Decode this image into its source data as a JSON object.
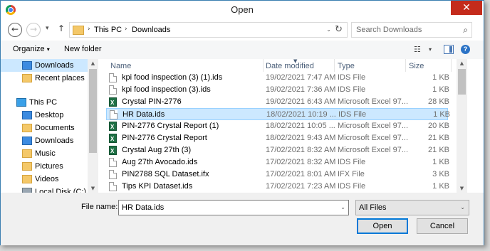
{
  "window": {
    "title": "Open",
    "close_glyph": "✕"
  },
  "nav": {
    "back_glyph": "←",
    "forward_glyph": "→",
    "recent_glyph": "▾",
    "up_glyph": "↑",
    "address": [
      "This PC",
      "Downloads"
    ],
    "address_sep": "›",
    "dropdown_glyph": "⌄",
    "refresh_glyph": "↻",
    "search_placeholder": "Search Downloads",
    "search_glyph": "⌕"
  },
  "toolbar": {
    "organize_label": "Organize",
    "organize_caret": "▾",
    "new_folder_label": "New folder",
    "view_glyph": "☷",
    "view_caret": "▾",
    "help_glyph": "?"
  },
  "sidebar": {
    "items": [
      {
        "label": "Downloads",
        "icon": "downloads-folder-icon",
        "selected": true
      },
      {
        "label": "Recent places",
        "icon": "recent-places-icon"
      },
      {
        "label": "This PC",
        "icon": "this-pc-icon"
      },
      {
        "label": "Desktop",
        "icon": "desktop-folder-icon"
      },
      {
        "label": "Documents",
        "icon": "documents-folder-icon"
      },
      {
        "label": "Downloads",
        "icon": "downloads-folder-icon"
      },
      {
        "label": "Music",
        "icon": "music-folder-icon"
      },
      {
        "label": "Pictures",
        "icon": "pictures-folder-icon"
      },
      {
        "label": "Videos",
        "icon": "videos-folder-icon"
      },
      {
        "label": "Local Disk (C:)",
        "icon": "local-disk-icon"
      }
    ]
  },
  "columns": {
    "name": "Name",
    "date": "Date modified",
    "type": "Type",
    "size": "Size"
  },
  "files": [
    {
      "name": "kpi food inspection (3) (1).ids",
      "date": "19/02/2021 7:47 AM",
      "type": "IDS File",
      "size": "1 KB",
      "icon": "doc"
    },
    {
      "name": "kpi food inspection (3).ids",
      "date": "19/02/2021 7:36 AM",
      "type": "IDS File",
      "size": "1 KB",
      "icon": "doc"
    },
    {
      "name": "Crystal PIN-2776",
      "date": "19/02/2021 6:43 AM",
      "type": "Microsoft Excel 97...",
      "size": "28 KB",
      "icon": "xls"
    },
    {
      "name": "HR Data.ids",
      "date": "18/02/2021 10:19 ...",
      "type": "IDS File",
      "size": "1 KB",
      "icon": "doc",
      "selected": true
    },
    {
      "name": "PIN-2776 Crystal Report (1)",
      "date": "18/02/2021 10:05 ...",
      "type": "Microsoft Excel 97...",
      "size": "20 KB",
      "icon": "xls"
    },
    {
      "name": "PIN-2776 Crystal Report",
      "date": "18/02/2021 9:43 AM",
      "type": "Microsoft Excel 97...",
      "size": "21 KB",
      "icon": "xls"
    },
    {
      "name": "Crystal Aug 27th (3)",
      "date": "17/02/2021 8:32 AM",
      "type": "Microsoft Excel 97...",
      "size": "21 KB",
      "icon": "xls"
    },
    {
      "name": "Aug 27th Avocado.ids",
      "date": "17/02/2021 8:32 AM",
      "type": "IDS File",
      "size": "1 KB",
      "icon": "doc"
    },
    {
      "name": "PIN2788 SQL Dataset.ifx",
      "date": "17/02/2021 8:01 AM",
      "type": "IFX File",
      "size": "3 KB",
      "icon": "doc"
    },
    {
      "name": "Tips KPI Dataset.ids",
      "date": "17/02/2021 7:23 AM",
      "type": "IDS File",
      "size": "1 KB",
      "icon": "doc"
    }
  ],
  "footer": {
    "file_name_label": "File name:",
    "file_name_value": "HR Data.ids",
    "filter_value": "All Files",
    "open_label": "Open",
    "cancel_label": "Cancel",
    "caret": "⌄"
  }
}
